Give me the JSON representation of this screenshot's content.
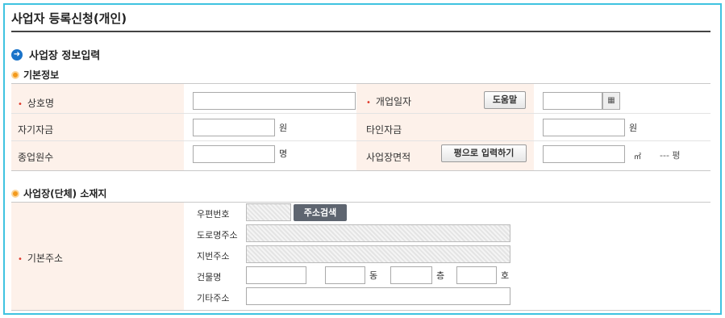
{
  "page": {
    "title": "사업자 등록신청(개인)",
    "section_title": "사업장 정보입력",
    "section_icon": "arrow-right-circle-icon"
  },
  "basic_info": {
    "heading": "기본정보",
    "required_mark": "•",
    "trade_name_label": "상호명",
    "open_date_label": "개업일자",
    "help_button": "도움말",
    "calendar_icon": "calendar-icon",
    "own_capital_label": "자기자금",
    "own_capital_unit": "원",
    "other_capital_label": "타인자금",
    "other_capital_unit": "원",
    "employees_label": "종업원수",
    "employees_unit": "명",
    "area_label": "사업장면적",
    "pyeong_button": "평으로 입력하기",
    "area_unit": "㎡",
    "pyeong_value": "--- 평"
  },
  "address": {
    "heading": "사업장(단체) 소재지",
    "label": "기본주소",
    "postcode_label": "우편번호",
    "search_button": "주소검색",
    "road_label": "도로명주소",
    "lot_label": "지번주소",
    "building_label": "건물명",
    "dong_unit": "동",
    "floor_unit": "층",
    "ho_unit": "호",
    "extra_label": "기타주소"
  },
  "colors": {
    "frame_border": "#3fc3e0",
    "label_bg": "#fdf1ea",
    "required": "#e03a2c",
    "section_icon": "#1a73c9",
    "sub_icon": "#f39a1d"
  }
}
